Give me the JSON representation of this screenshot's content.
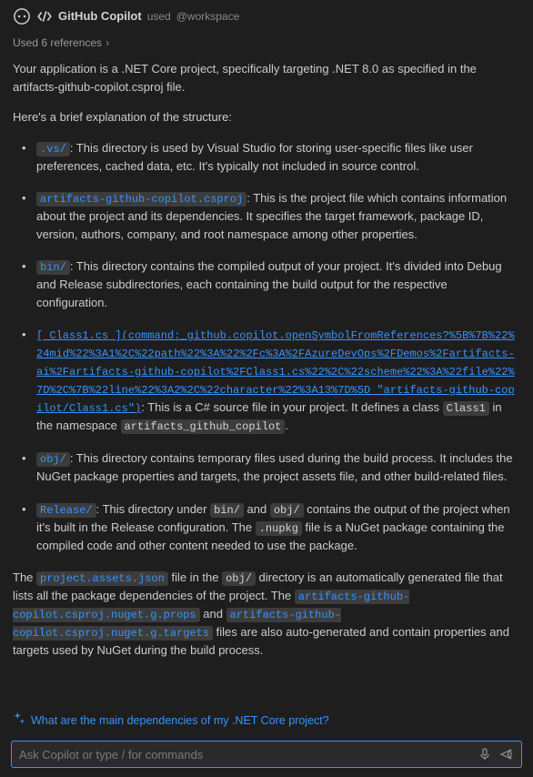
{
  "header": {
    "title": "GitHub Copilot",
    "used": "used",
    "workspace_tag": "@workspace"
  },
  "references": {
    "label": "Used 6 references",
    "chev": "›"
  },
  "intro_part1": "Your application is a .NET Core project, specifically targeting .NET 8.0 as specified in the artifacts-github-copilot.csproj file.",
  "intro_part2": "Here's a brief explanation of the structure:",
  "items": [
    {
      "chip": ".vs/",
      "text": ": This directory is used by Visual Studio for storing user-specific files like user preferences, cached data, etc. It's typically not included in source control."
    },
    {
      "chip": "artifacts-github-copilot.csproj",
      "text": ": This is the project file which contains information about the project and its dependencies. It specifies the target framework, package ID, version, authors, company, and root namespace among other properties."
    },
    {
      "chip": "bin/",
      "text": ": This directory contains the compiled output of your project. It's divided into Debug and Release subdirectories, each containing the build output for the respective configuration."
    }
  ],
  "class_item": {
    "link_text": "[ Class1.cs ](command:_github.copilot.openSymbolFromReferences?%5B%7B%22%24mid%22%3A1%2C%22path%22%3A%22%2Fc%3A%2FAzureDevOps%2FDemos%2Fartifacts-ai%2Fartifacts-github-copilot%2FClass1.cs%22%2C%22scheme%22%3A%22file%22%7D%2C%7B%22line%22%3A2%2C%22character%22%3A13%7D%5D \"artifacts-github-copilot/Class1.cs\")",
    "text_before": ": This is a C# source file in your project. It defines a class ",
    "chip_class": "Class1",
    "text_mid": " in the namespace ",
    "chip_ns": "artifacts_github_copilot",
    "text_after": "."
  },
  "items2": [
    {
      "chip": "obj/",
      "text": ": This directory contains temporary files used during the build process. It includes the NuGet package properties and targets, the project assets file, and other build-related files."
    }
  ],
  "release_item": {
    "chip_release": "Release/",
    "text1": ": This directory under ",
    "chip_bin": "bin/",
    "text2": " and ",
    "chip_obj": "obj/",
    "text3": " contains the output of the project when it's built in the Release configuration. The ",
    "chip_nupkg": ".nupkg",
    "text4": " file is a NuGet package containing the compiled code and other content needed to use the package."
  },
  "outro": {
    "t1": "The ",
    "chip1": "project.assets.json",
    "t2": " file in the ",
    "chip2": "obj/",
    "t3": " directory is an automatically generated file that lists all the package dependencies of the project. The ",
    "chip3": "artifacts-github-copilot.csproj.nuget.g.props",
    "t4": " and ",
    "chip4": "artifacts-github-copilot.csproj.nuget.g.targets",
    "t5": " files are also auto-generated and contain properties and targets used by NuGet during the build process."
  },
  "suggestion": {
    "text": "What are the main dependencies of my .NET Core project?"
  },
  "input": {
    "placeholder": "Ask Copilot or type / for commands"
  }
}
